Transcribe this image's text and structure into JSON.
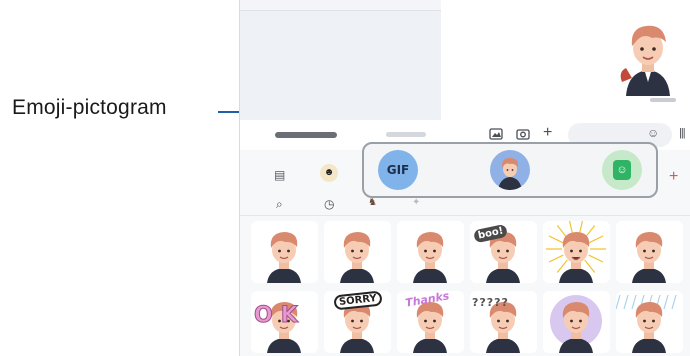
{
  "callout": {
    "label": "Emoji-pictogram"
  },
  "input_row": {
    "gallery_icon": "image-icon",
    "camera_icon": "camera-icon",
    "add_icon": "+",
    "emoji_icon": "☺",
    "voice_icon": "|||"
  },
  "panel": {
    "keyboard_icon": "▤",
    "add_label": "+",
    "sub_icons": {
      "search": "⌕",
      "recent": "◷"
    }
  },
  "highlight": {
    "gif_label": "GIF",
    "items": [
      "gif-button",
      "ar-emoji-button",
      "sticker-button"
    ]
  },
  "stickers": [
    {
      "row": 0,
      "col": 0,
      "text": ""
    },
    {
      "row": 0,
      "col": 1,
      "text": ""
    },
    {
      "row": 0,
      "col": 2,
      "text": ""
    },
    {
      "row": 0,
      "col": 3,
      "text": "boo!"
    },
    {
      "row": 0,
      "col": 4,
      "text": ""
    },
    {
      "row": 0,
      "col": 5,
      "text": ""
    },
    {
      "row": 1,
      "col": 0,
      "text": "OK"
    },
    {
      "row": 1,
      "col": 1,
      "text": "SORRY"
    },
    {
      "row": 1,
      "col": 2,
      "text": "Thanks"
    },
    {
      "row": 1,
      "col": 3,
      "text": "?????"
    },
    {
      "row": 1,
      "col": 4,
      "text": ""
    },
    {
      "row": 1,
      "col": 5,
      "text": ""
    }
  ],
  "colors": {
    "callout_line": "#1e5fa8",
    "highlight_border": "#9aa0a8",
    "add_red": "#e4554a",
    "gif_blue": "#7fb3ea",
    "sticker_green": "#2fb365",
    "hair": "#d98a6e",
    "skin": "#f6cdb4",
    "jacket": "#2d3242"
  }
}
